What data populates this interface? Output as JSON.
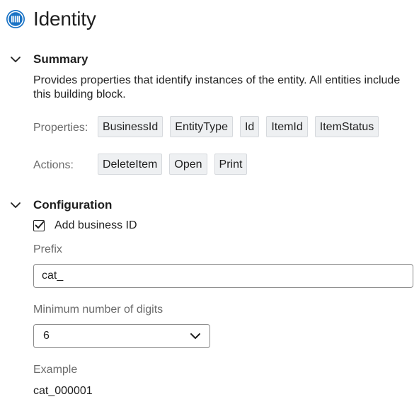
{
  "header": {
    "title": "Identity",
    "icon": "barcode-badge-icon",
    "accent_color": "#1a73c5"
  },
  "summary": {
    "title": "Summary",
    "expanded": true,
    "description": "Provides properties that identify instances of the entity. All entities include this building block.",
    "properties_label": "Properties:",
    "properties": [
      "BusinessId",
      "EntityType",
      "Id",
      "ItemId",
      "ItemStatus"
    ],
    "actions_label": "Actions:",
    "actions": [
      "DeleteItem",
      "Open",
      "Print"
    ]
  },
  "configuration": {
    "title": "Configuration",
    "expanded": true,
    "add_business_id": {
      "label": "Add business ID",
      "checked": true
    },
    "prefix": {
      "label": "Prefix",
      "value": "cat_"
    },
    "min_digits": {
      "label": "Minimum number of digits",
      "value": "6"
    },
    "example": {
      "label": "Example",
      "value": "cat_000001"
    }
  }
}
